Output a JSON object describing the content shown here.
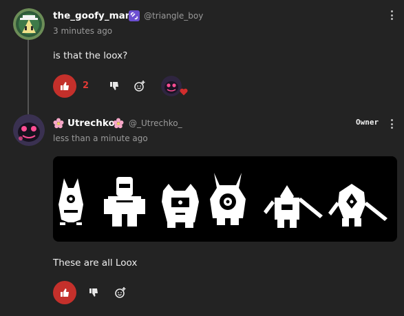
{
  "comment1": {
    "username": "the_goofy_man",
    "handle": "@triangle_boy",
    "time": "3 minutes ago",
    "text": "is that the loox?",
    "like_count": "2",
    "avatar_icon": "cowboy-bell-avatar",
    "badge_icon": "link-icon"
  },
  "comment2": {
    "username": "Utrechko",
    "handle": "@_Utrechko_",
    "time": "less than a minute ago",
    "text": "These are all Loox",
    "owner_label": "Owner",
    "avatar_icon": "loox-monster-avatar",
    "flower_icon": "cherry-blossom-icon"
  },
  "colors": {
    "background": "#232323",
    "like": "#c4302b",
    "like_count": "#e23a35",
    "badge": "#6c4fd1",
    "muted": "#9a9a9a"
  }
}
